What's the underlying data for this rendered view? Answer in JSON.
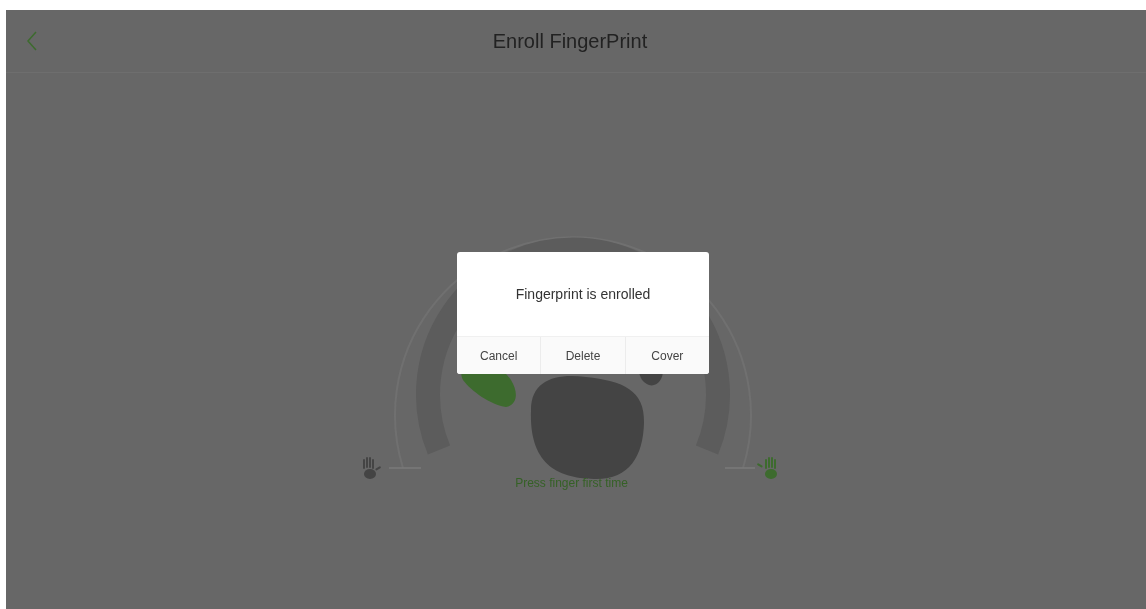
{
  "header": {
    "title": "Enroll FingerPrint"
  },
  "status_text": "Press finger first time",
  "dialog": {
    "message": "Fingerprint is enrolled",
    "buttons": [
      "Cancel",
      "Delete",
      "Cover"
    ]
  }
}
